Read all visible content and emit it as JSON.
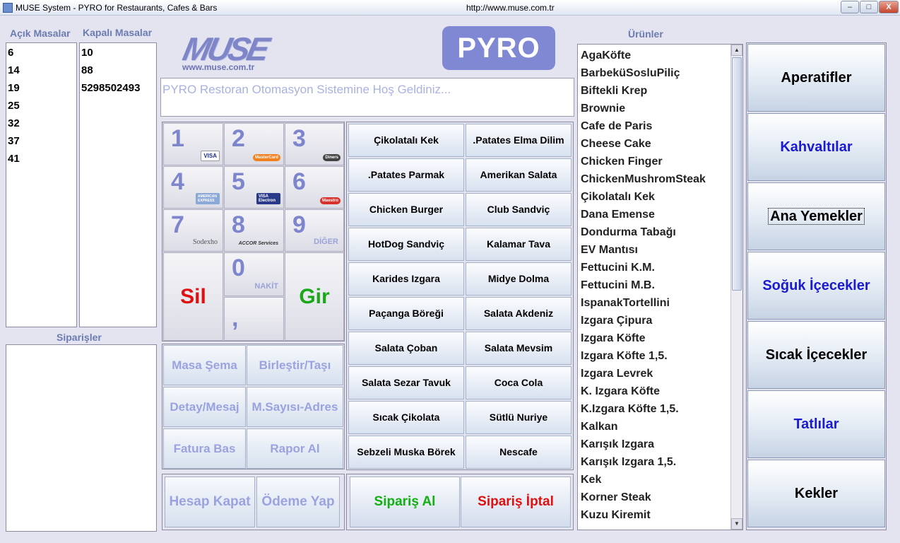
{
  "window": {
    "title": "MUSE System - PYRO for Restaurants, Cafes & Bars",
    "url": "http://www.muse.com.tr",
    "min_label": "–",
    "max_label": "□",
    "close_label": "X"
  },
  "tables": {
    "open_header": "Açık Masalar",
    "closed_header": "Kapalı Masalar",
    "open": [
      "6",
      "14",
      "19",
      "25",
      "32",
      "37",
      "41"
    ],
    "closed": [
      "10",
      "88",
      "5298502493"
    ]
  },
  "orders": {
    "header": "Siparişler"
  },
  "logo": {
    "text": "MUSE",
    "url": "www.muse.com.tr",
    "pyro": "PYRO"
  },
  "welcome": "PYRO Restoran Otomasyon Sistemine Hoş Geldiniz...",
  "keypad": {
    "keys": [
      "1",
      "2",
      "3",
      "4",
      "5",
      "6",
      "7",
      "8",
      "9",
      "0",
      ","
    ],
    "cards": [
      "VISA",
      "MasterCard",
      "Diners",
      "AMERICAN EXPRESS",
      "VISA Electron",
      "Maestro",
      "Sodexho",
      "ACCOR Services",
      "DİĞER",
      "NAKİT"
    ],
    "sil": "Sil",
    "gir": "Gir"
  },
  "func": {
    "masa_sema": "Masa Şema",
    "birlestir": "Birleştir/Taşı",
    "detay": "Detay/Mesaj",
    "msayisi": "M.Sayısı-Adres",
    "fatura": "Fatura Bas",
    "rapor": "Rapor Al",
    "hesap": "Hesap Kapat",
    "odeme": "Ödeme Yap"
  },
  "quick_items": [
    "Çikolatalı Kek",
    ".Patates Elma Dilim",
    ".Patates Parmak",
    "Amerikan Salata",
    "Chicken Burger",
    "Club Sandviç",
    "HotDog Sandviç",
    "Kalamar Tava",
    "Karides Izgara",
    "Midye Dolma",
    "Paçanga Böreği",
    "Salata Akdeniz",
    "Salata Çoban",
    "Salata Mevsim",
    "Salata Sezar Tavuk",
    "Coca Cola",
    "Sıcak Çikolata",
    "Sütlü Nuriye",
    "Sebzeli Muska Börek",
    "Nescafe"
  ],
  "order_actions": {
    "take": "Sipariş Al",
    "cancel": "Sipariş İptal"
  },
  "products": {
    "header": "Ürünler",
    "items": [
      "AgaKöfte",
      "BarbeküSosluPiliç",
      "Biftekli Krep",
      "Brownie",
      "Cafe de Paris",
      "Cheese Cake",
      "Chicken Finger",
      "ChickenMushromSteak",
      "Çikolatalı Kek",
      "Dana Emense",
      "Dondurma Tabağı",
      "EV Mantısı",
      "Fettucini K.M.",
      "Fettucini M.B.",
      "IspanakTortellini",
      "Izgara Çipura",
      "Izgara Köfte",
      "Izgara Köfte 1,5.",
      "Izgara Levrek",
      "K. Izgara Köfte",
      "K.Izgara Köfte 1,5.",
      "Kalkan",
      "Karışık Izgara",
      "Karışık Izgara 1,5.",
      "Kek",
      "Korner Steak",
      "Kuzu  Kiremit"
    ]
  },
  "categories": [
    {
      "label": "Aperatifler",
      "color": "#000000"
    },
    {
      "label": "Kahvaltılar",
      "color": "#1a1ad0"
    },
    {
      "label": "Ana Yemekler",
      "color": "#000000"
    },
    {
      "label": "Soğuk İçecekler",
      "color": "#1a1ad0"
    },
    {
      "label": "Sıcak İçecekler",
      "color": "#000000"
    },
    {
      "label": "Tatlılar",
      "color": "#1a1ad0"
    },
    {
      "label": "Kekler",
      "color": "#000000"
    }
  ],
  "colors": {
    "sil": "#e01010",
    "gir": "#1aa81a",
    "take": "#12b012",
    "cancel": "#e01010",
    "accent": "#7d86cc"
  }
}
